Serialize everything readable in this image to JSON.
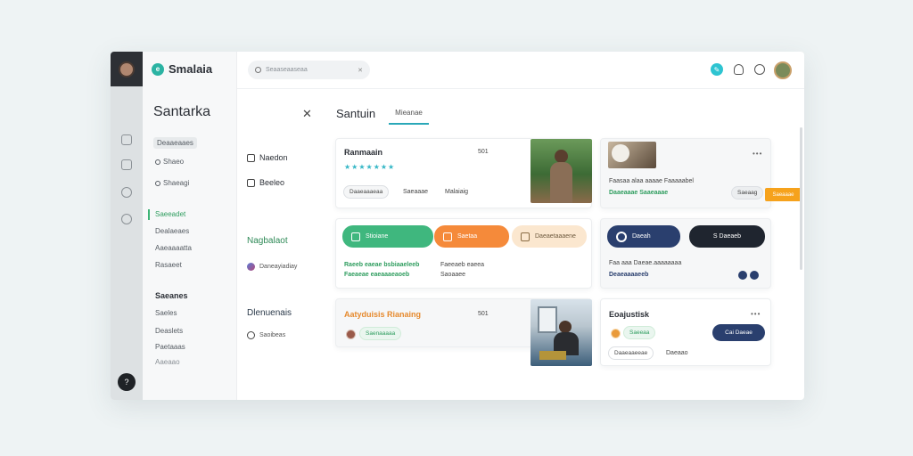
{
  "app": {
    "name": "Smalaia"
  },
  "nav": {
    "title": "Santarka",
    "items": [
      {
        "label": "Deaaeaaes",
        "pill": true
      },
      {
        "label": "Shaeo",
        "icon": true
      },
      {
        "label": "Shaeagi",
        "icon": true
      },
      {
        "label": "Saeeadet",
        "active": true
      },
      {
        "label": "Dealaeaes"
      },
      {
        "label": "Aaeaaaatta"
      },
      {
        "label": "Rasaeet"
      }
    ],
    "section_title": "Saeanes",
    "section_items": [
      "Saeles",
      "Deaslets",
      "Paetaaas",
      "Aaeaao"
    ]
  },
  "search": {
    "placeholder": "Seaaseaaseaa"
  },
  "mid": {
    "items": [
      "Naedon",
      "Beeleo"
    ],
    "head1": "Nagbalaot",
    "sub1": "Daneayiadiay",
    "head2": "Dlenuenais",
    "sub2": "Saoibeas"
  },
  "content": {
    "title": "Santuin",
    "tab": "Mieanae"
  },
  "card1": {
    "title": "Ranmaain",
    "meta": "501",
    "stars": "★★★★★★★",
    "chips": [
      "Daaeaaaeaa",
      "Saeaaae",
      "Malaiaig"
    ]
  },
  "card2": {
    "badge": "Saeaaae",
    "text": "Faasaa alaa aaaae Faaaaabel",
    "link": "Daaeaaae Saaeaaae",
    "chip": "Saeaag"
  },
  "card3": {
    "buttons": [
      "Stioiane",
      "Saetaa",
      "Daeaetaaaene"
    ],
    "line1": "Raeeb eaeae bsbiaaeleeb",
    "line2": "Faeaeae eaeaaaeaoeb",
    "line3": "Faeeaeb eaeea",
    "line4": "Saoaaee"
  },
  "card4": {
    "buttons": [
      "Daeah",
      "S Daeaeb"
    ],
    "text": "Faa aaa Daeae.aaaaaaaa",
    "link": "Deaeaaaaeeb"
  },
  "card5": {
    "title": "Aatyduisis Rianaing",
    "meta": "501",
    "chip": "Saenaaaaa"
  },
  "card6": {
    "title": "Eoajustisk",
    "dots": "•••",
    "chip1": "Saeeaa",
    "button": "Cai Daeae",
    "chip2": "Daaeaaeeae",
    "text2": "Daeaao"
  },
  "colors": {
    "teal": "#2bb3a3",
    "green": "#3fb77e",
    "orange": "#f58a3a",
    "navy": "#2a3f6e",
    "dark": "#1f252f"
  }
}
